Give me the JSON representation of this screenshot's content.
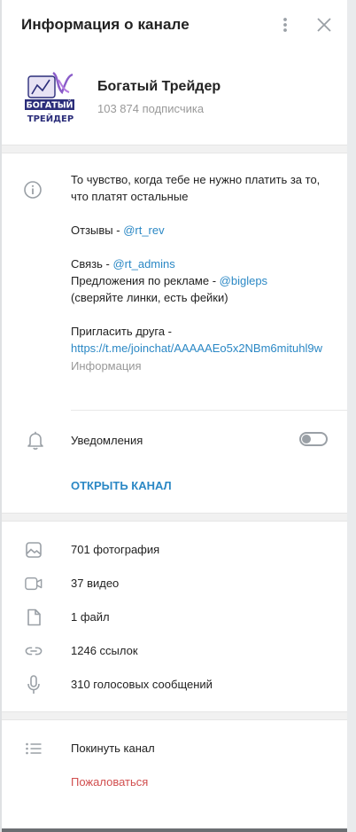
{
  "header": {
    "title": "Информация о канале",
    "menu_icon": "more-vertical-icon",
    "close_icon": "close-icon"
  },
  "channel": {
    "name": "Богатый Трейдер",
    "subscribers": "103 874 подписчика",
    "avatar_text_top": "БОГАТЫЙ",
    "avatar_text_bottom": "ТРЕЙДЕР"
  },
  "description": {
    "line1": "То чувство, когда тебе не нужно платить за то, что платят остальные",
    "reviews_label": "Отзывы - ",
    "reviews_link": "@rt_rev",
    "contact_label": "Связь - ",
    "contact_link": "@rt_admins",
    "ads_label": "Предложения по рекламе - ",
    "ads_link": "@bigleps",
    "ads_note": "(сверяйте линки, есть фейки)",
    "invite_label": "Пригласить друга -",
    "invite_link": "https://t.me/joinchat/AAAAAEo5x2NBm6mituhl9w",
    "caption": "Информация"
  },
  "notifications": {
    "label": "Уведомления",
    "enabled": false
  },
  "open_channel": "ОТКРЫТЬ КАНАЛ",
  "media": [
    {
      "icon": "photo-icon",
      "label": "701 фотография"
    },
    {
      "icon": "video-icon",
      "label": "37 видео"
    },
    {
      "icon": "file-icon",
      "label": "1 файл"
    },
    {
      "icon": "link-icon",
      "label": "1246 ссылок"
    },
    {
      "icon": "microphone-icon",
      "label": "310 голосовых сообщений"
    }
  ],
  "actions": {
    "leave": "Покинуть канал",
    "report": "Пожаловаться"
  },
  "colors": {
    "accent": "#2b88c5",
    "danger": "#d14e4e",
    "muted": "#999999",
    "icon": "#9aa0a6"
  }
}
